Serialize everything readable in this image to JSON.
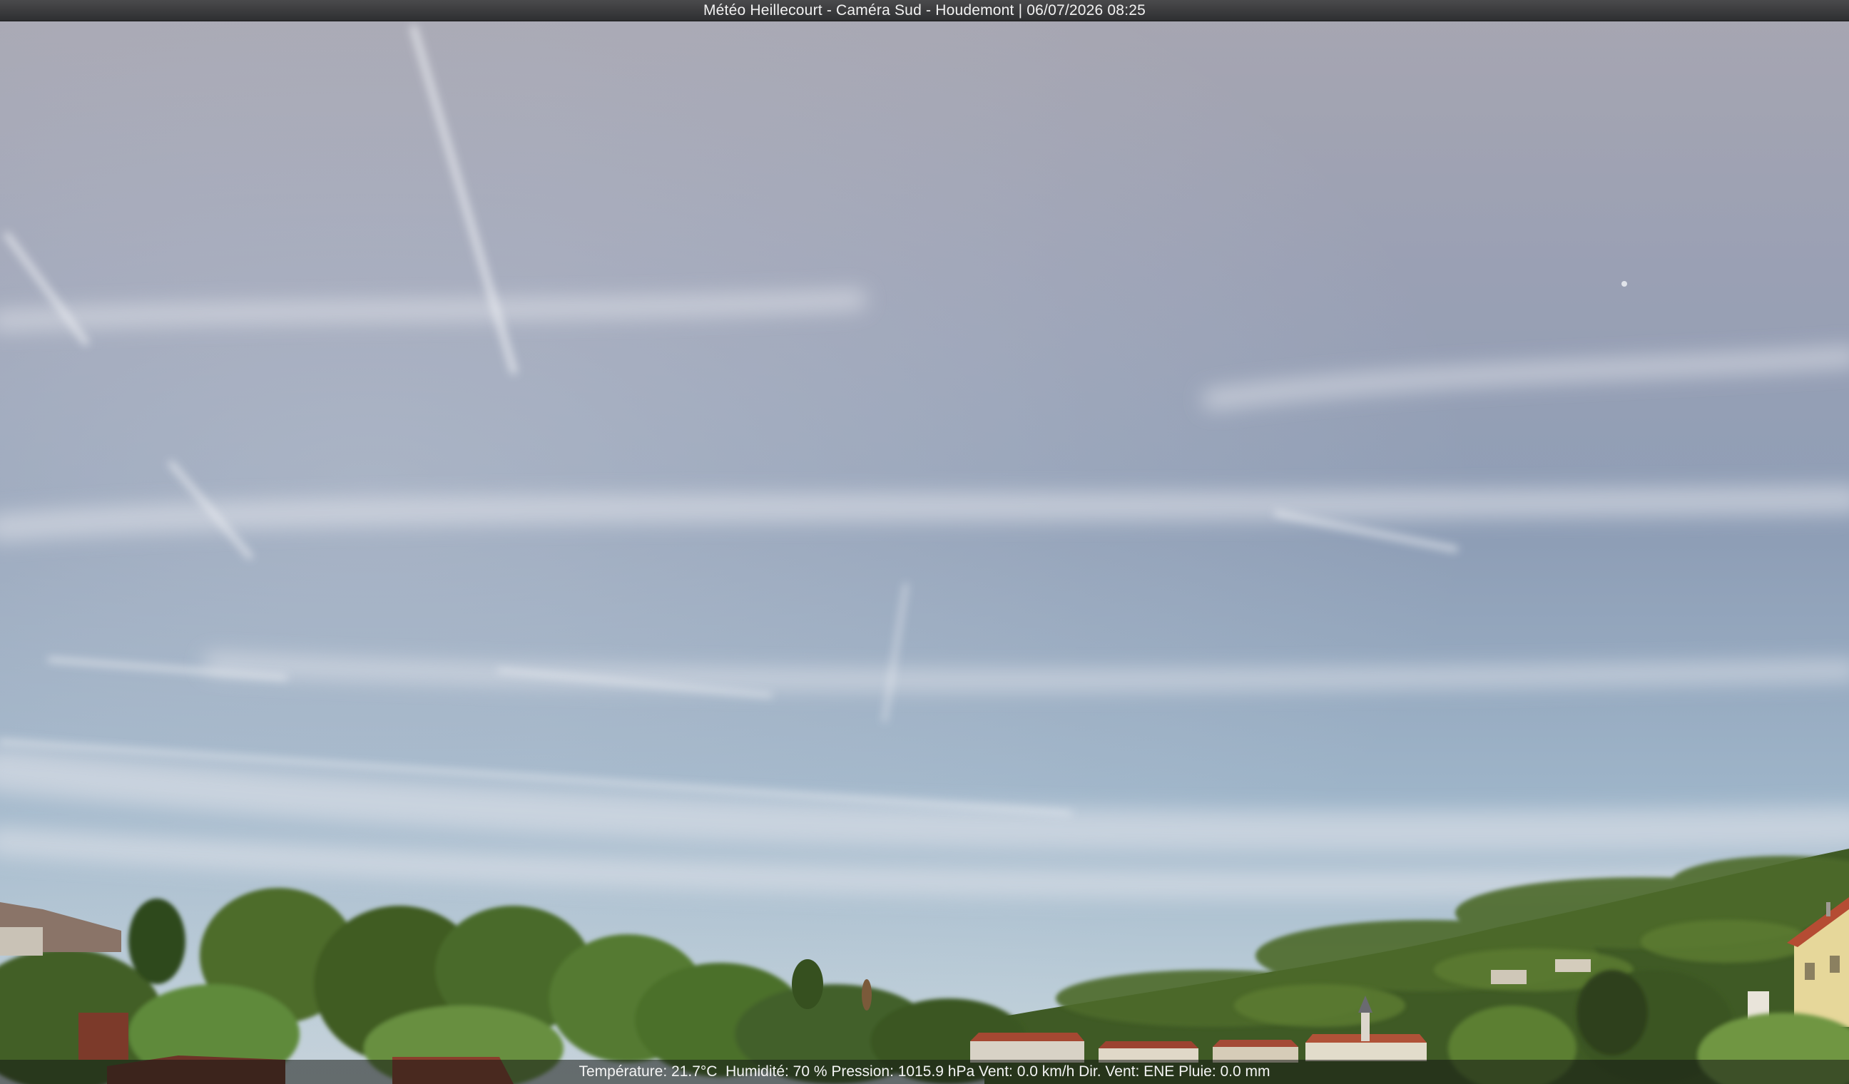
{
  "overlay": {
    "title": "Météo Heillecourt - Caméra Sud - Houdemont | 06/07/2026 08:25",
    "weather_line": "Température: 21.7°C  Humidité: 70 % Pression: 1015.9 hPa Vent: 0.0 km/h Dir. Vent: ENE Pluie: 0.0 mm"
  },
  "colors": {
    "sky_top": "#a4a3af",
    "sky_mid": "#8a9bb5",
    "sky_low": "#b9cbd8",
    "foliage": "#3d5a22",
    "roof": "#9c4a35"
  }
}
